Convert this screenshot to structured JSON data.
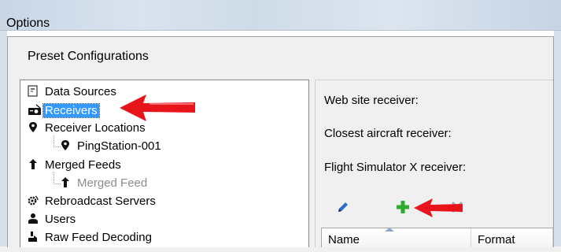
{
  "window": {
    "title": "Options"
  },
  "panel": {
    "title": "Preset Configurations"
  },
  "tree": {
    "items": [
      {
        "label": "Data Sources",
        "icon": "data-sources-icon"
      },
      {
        "label": "Receivers",
        "icon": "radio-icon",
        "selected": true
      },
      {
        "label": "Receiver Locations",
        "icon": "map-pin-icon"
      },
      {
        "label": "PingStation-001",
        "icon": "map-pin-icon"
      },
      {
        "label": "Merged Feeds",
        "icon": "merge-arrow-icon"
      },
      {
        "label": "Merged Feed",
        "icon": "merge-arrow-icon",
        "disabled": true
      },
      {
        "label": "Rebroadcast Servers",
        "icon": "broadcast-gear-icon"
      },
      {
        "label": "Users",
        "icon": "user-icon"
      },
      {
        "label": "Raw Feed Decoding",
        "icon": "decoding-icon"
      }
    ]
  },
  "receivers": {
    "web_site_label": "Web site receiver:",
    "closest_aircraft_label": "Closest aircraft receiver:",
    "flight_sim_label": "Flight Simulator X receiver:"
  },
  "toolbar": {
    "edit_icon": "pencil-icon",
    "add_icon": "plus-icon",
    "delete_icon": "delete-x-icon"
  },
  "grid": {
    "columns": [
      "Name",
      "Format"
    ]
  },
  "colors": {
    "selection": "#3399ff",
    "annotation_arrow": "#e8141b",
    "add_green": "#2eaa2e"
  }
}
